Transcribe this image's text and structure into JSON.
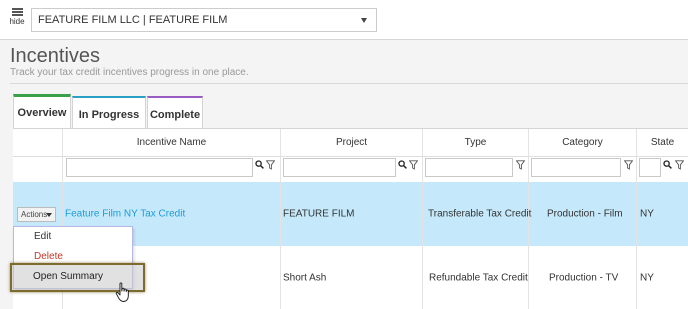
{
  "topbar": {
    "hide_label": "hide",
    "company_select_value": "FEATURE FILM LLC | FEATURE FILM"
  },
  "page": {
    "title": "Incentives",
    "subtitle": "Track your tax credit incentives progress in one place."
  },
  "tabs": [
    {
      "label": "Overview",
      "accent": "#3aa14a"
    },
    {
      "label": "In Progress",
      "accent": "#2aa1c4"
    },
    {
      "label": "Complete",
      "accent": "#9b5cc4"
    }
  ],
  "grid": {
    "columns": [
      "",
      "Incentive Name",
      "Project",
      "Type",
      "Category",
      "State"
    ],
    "rows": [
      {
        "actions_label": "Actions",
        "incentive_name": "Feature Film NY Tax Credit",
        "project": "FEATURE FILM",
        "type": "Transferable Tax Credit",
        "category": "Production - Film",
        "state": "NY"
      },
      {
        "incentive_name": "",
        "project": "Short Ash",
        "type": "Refundable Tax Credit",
        "category": "Production - TV",
        "state": "NY"
      }
    ]
  },
  "actions_menu": {
    "items": [
      "Edit",
      "Delete",
      "Open Summary"
    ],
    "highlighted": "Open Summary"
  },
  "colors": {
    "selected_row": "#c5e9fb",
    "link": "#1e9bd8",
    "delete": "#c0392b",
    "highlight_border": "#7d6b2e"
  },
  "icons": {
    "search": "search-icon",
    "filter": "filter-icon",
    "hide": "hamburger-icon",
    "cursor": "hand-pointer-icon"
  }
}
